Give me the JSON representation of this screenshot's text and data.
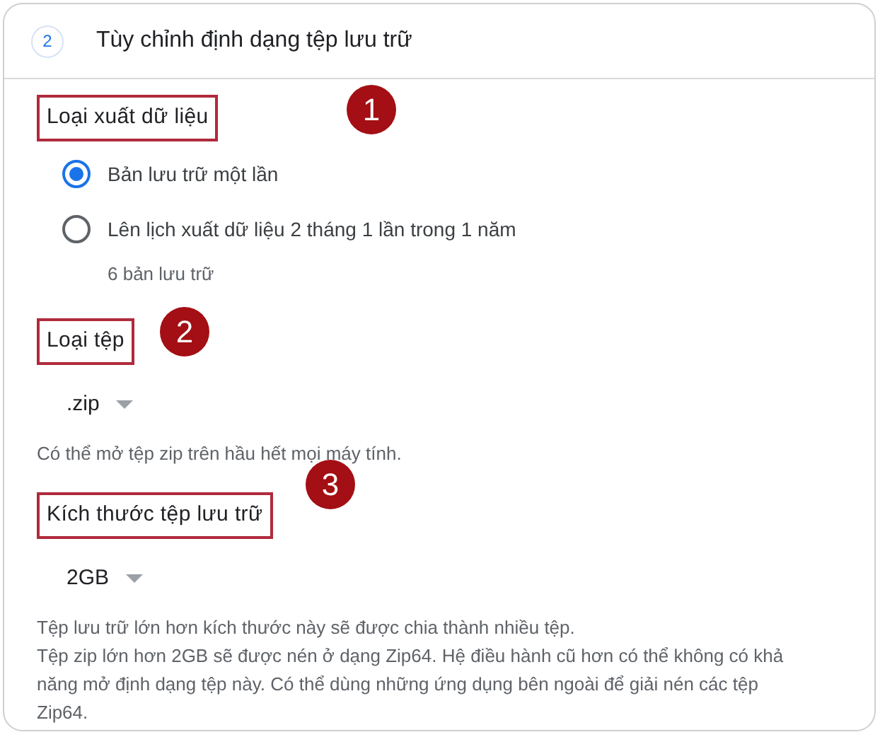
{
  "step": {
    "number": "2",
    "title": "Tùy chỉnh định dạng tệp lưu trữ"
  },
  "sections": [
    {
      "kind": "radios",
      "heading": "Loại xuất dữ liệu",
      "badge": "1",
      "options": [
        {
          "label": "Bản lưu trữ một lần",
          "selected": true
        },
        {
          "label": "Lên lịch xuất dữ liệu 2 tháng 1 lần trong 1 năm",
          "selected": false,
          "note": "6 bản lưu trữ"
        }
      ]
    },
    {
      "kind": "dropdown",
      "heading": "Loại tệp",
      "badge": "2",
      "value": ".zip",
      "help": [
        "Có thể mở tệp zip trên hầu hết mọi máy tính."
      ]
    },
    {
      "kind": "dropdown",
      "heading": "Kích thước tệp lưu trữ",
      "badge": "3",
      "value": "2GB",
      "help": [
        "Tệp lưu trữ lớn hơn kích thước này sẽ được chia thành nhiều tệp.",
        "Tệp zip lớn hơn 2GB sẽ được nén ở dạng Zip64. Hệ điều hành cũ hơn có thể không có khả năng mở định dạng tệp này. Có thể dùng những ứng dụng bên ngoài để giải nén các tệp Zip64."
      ]
    }
  ]
}
